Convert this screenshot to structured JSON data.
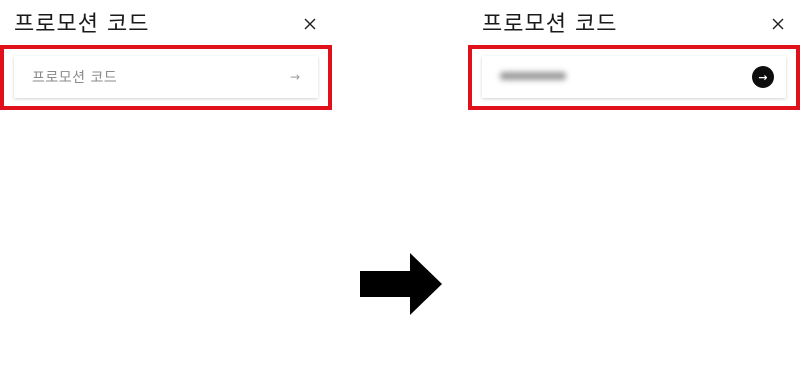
{
  "before": {
    "title": "프로모션 코드",
    "close_icon": "close-icon",
    "input_placeholder": "프로모션 코드",
    "submit_icon": "arrow-right-icon"
  },
  "after": {
    "title": "프로모션 코드",
    "close_icon": "close-icon",
    "input_value": "",
    "submit_icon": "arrow-right-circle-icon"
  },
  "transition_arrow": "right-arrow-icon",
  "colors": {
    "highlight": "#e0111a",
    "button_active": "#0d0d0d",
    "placeholder_text": "#8a8a8a"
  }
}
